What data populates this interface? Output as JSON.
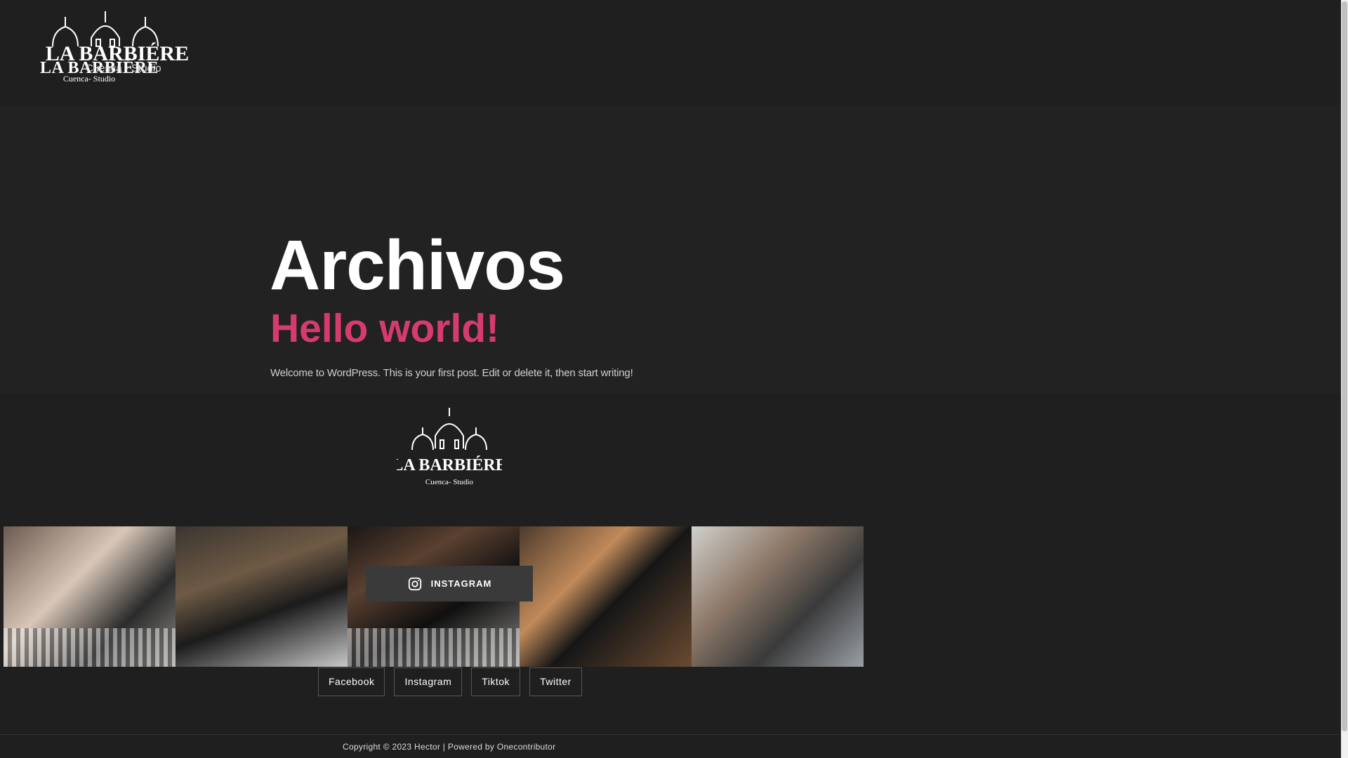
{
  "brand": {
    "logo_name": "LA BARBIÉRE",
    "logo_tagline": "Cuenca- Studio",
    "overlay_name": "LA BARBIÉRE",
    "overlay_sub": "Cuenca - Studio"
  },
  "archive": {
    "page_title": "Archivos",
    "post_title": "Hello world!",
    "post_excerpt": "Welcome to WordPress. This is your first post. Edit or delete it, then start writing!"
  },
  "footer": {
    "instagram_button": "INSTAGRAM",
    "social": [
      "Facebook",
      "Instagram",
      "Tiktok",
      "Twitter"
    ],
    "copyright": "Copyright © 2023 Hector | Powered by Onecontributor"
  },
  "colors": {
    "background": "#1f1f1f",
    "section": "#222222",
    "accent": "#d63b6e",
    "text": "#ffffff"
  },
  "icons": {
    "instagram": "instagram-icon"
  }
}
